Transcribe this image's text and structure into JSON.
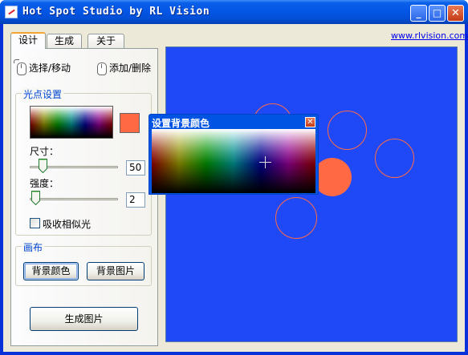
{
  "window": {
    "title": "Hot Spot Studio by RL Vision",
    "minimize_glyph": "_",
    "maximize_glyph": "□",
    "close_glyph": "✕"
  },
  "tabs": [
    {
      "label": "设计",
      "active": true
    },
    {
      "label": "生成",
      "active": false
    },
    {
      "label": "关于",
      "active": false
    }
  ],
  "link": "www.rlvision.com",
  "tools": {
    "select_move": "选择/移动",
    "add_delete": "添加/删除"
  },
  "spot_settings": {
    "group_title": "光点设置",
    "selected_color": "#ff6a45",
    "size_label": "尺寸：",
    "size_value": "50",
    "intensity_label": "强度：",
    "intensity_value": "2",
    "absorb_label": "吸收相似光",
    "absorb_checked": false
  },
  "canvas_group": {
    "group_title": "画布",
    "bg_color_button": "背景颜色",
    "bg_image_button": "背景图片"
  },
  "generate_button": "生成图片",
  "canvas": {
    "background_color": "#1f48f7",
    "spot_color": "#ff6a45"
  },
  "color_dialog": {
    "title": "设置背景颜色",
    "close_glyph": "✕"
  }
}
